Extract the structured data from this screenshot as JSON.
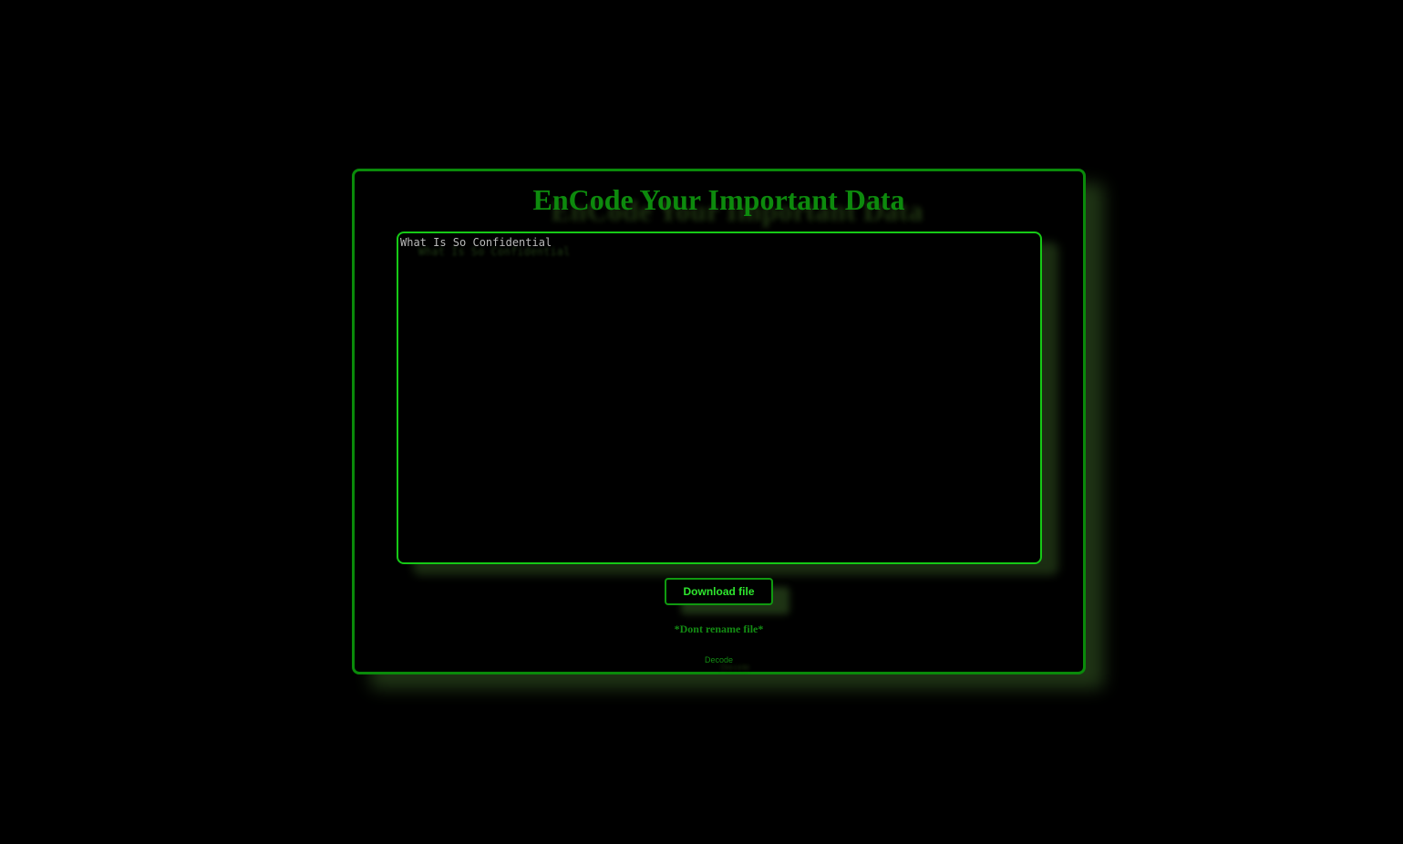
{
  "page": {
    "title": "EnCode Your Important Data",
    "input": {
      "value": "",
      "placeholder": "What Is So Confidential"
    },
    "download_button_label": "Download file",
    "note": "*Dont rename file*",
    "decode_link_label": "Decode"
  },
  "colors": {
    "background": "#000000",
    "accent": "#16c916",
    "title": "#0d8a0d",
    "button_text": "#2ee62e"
  }
}
